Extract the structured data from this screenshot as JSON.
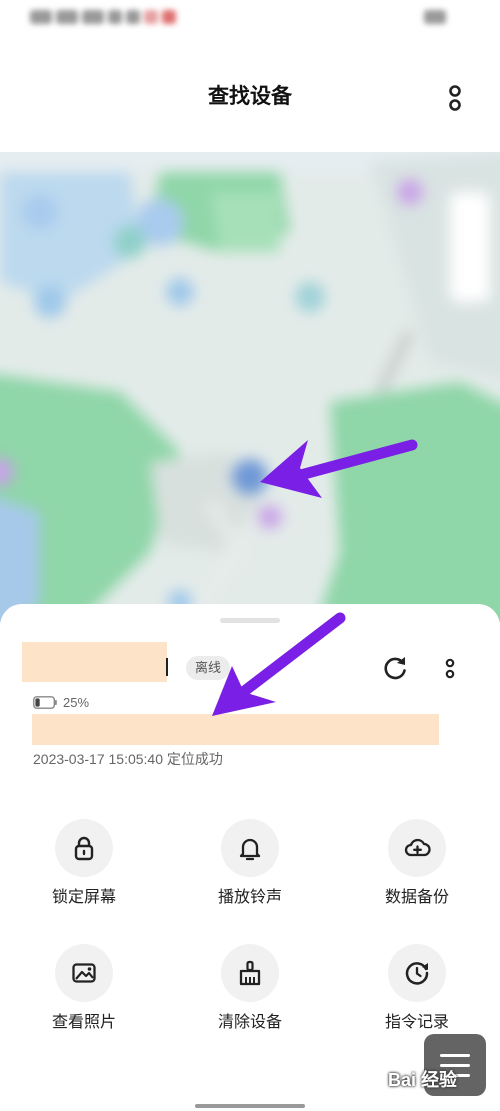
{
  "header": {
    "title": "查找设备"
  },
  "map": {
    "icons": [
      "device-marker-icon",
      "arrow-icon"
    ]
  },
  "device": {
    "status_badge": "离线",
    "battery": 25,
    "battery_label": "25%",
    "locate_text": "2023-03-17 15:05:40 定位成功"
  },
  "actions": [
    {
      "label": "锁定屏幕",
      "icon": "lock-icon"
    },
    {
      "label": "播放铃声",
      "icon": "bell-icon"
    },
    {
      "label": "数据备份",
      "icon": "cloud-add-icon"
    },
    {
      "label": "查看照片",
      "icon": "photo-icon"
    },
    {
      "label": "清除设备",
      "icon": "broom-icon"
    },
    {
      "label": "指令记录",
      "icon": "clock-history-icon"
    }
  ],
  "watermark": {
    "text": "Bai 经验"
  },
  "colors": {
    "arrow": "#7a1fe6",
    "mask": "#fde3c8",
    "map_green": "#8fd6a8",
    "map_water": "#9fc8e8"
  }
}
